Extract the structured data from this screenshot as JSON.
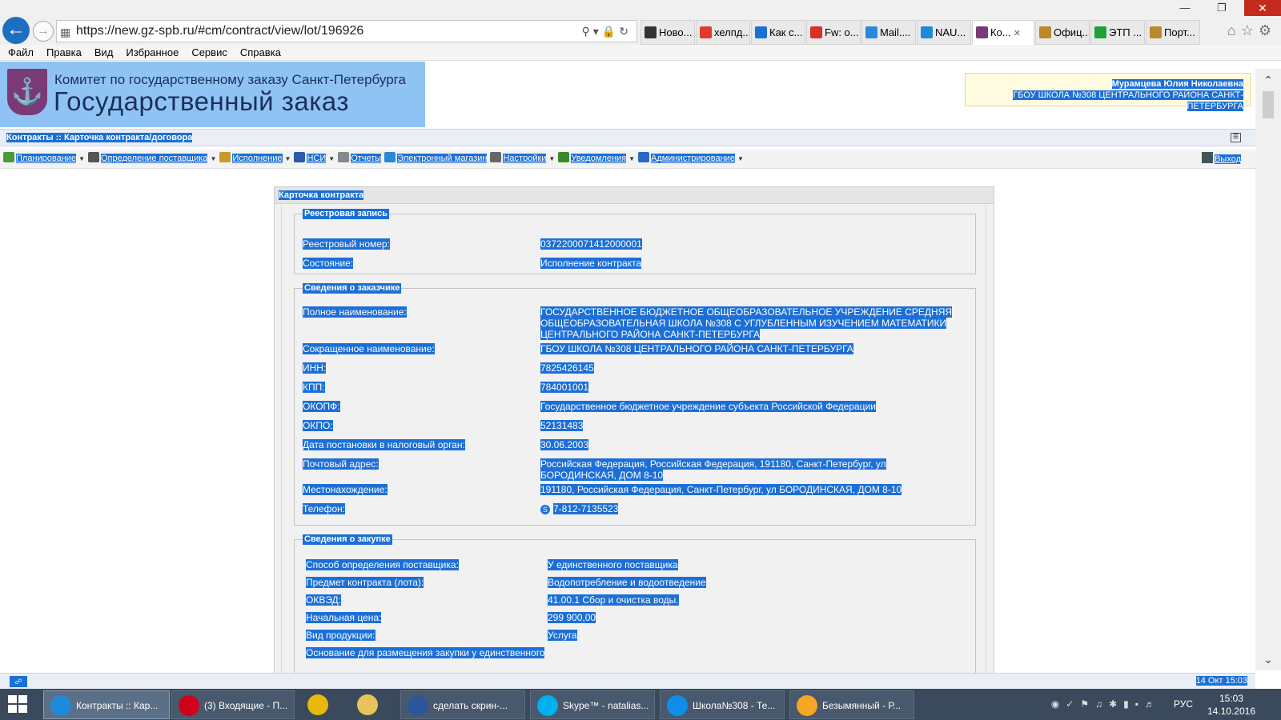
{
  "browser": {
    "url": "https://new.gz-spb.ru/#cm/contract/view/lot/196926",
    "tabs": [
      {
        "label": "Ново...",
        "icon": "document-icon",
        "color": "#333333"
      },
      {
        "label": "хелпд...",
        "icon": "yandex-icon",
        "color": "#e03a2f"
      },
      {
        "label": "Как с...",
        "icon": "help-icon",
        "color": "#1c6fd6"
      },
      {
        "label": "Fw: о...",
        "icon": "gmail-icon",
        "color": "#d93025"
      },
      {
        "label": "Mail....",
        "icon": "mail-icon",
        "color": "#2a88d8"
      },
      {
        "label": "NAU...",
        "icon": "ie-icon",
        "color": "#1e8ad8"
      },
      {
        "label": "Ко...",
        "icon": "gz-icon",
        "color": "#7a3a78",
        "active": true
      },
      {
        "label": "Офиц...",
        "icon": "emblem-icon",
        "color": "#b88a2c"
      },
      {
        "label": "ЭТП ...",
        "icon": "sberbank-icon",
        "color": "#21a038"
      },
      {
        "label": "Порт...",
        "icon": "emblem-icon",
        "color": "#b88a2c"
      }
    ],
    "menu": [
      "Файл",
      "Правка",
      "Вид",
      "Избранное",
      "Сервис",
      "Справка"
    ]
  },
  "header": {
    "subtitle": "Комитет по государственному заказу Санкт-Петербурга",
    "title": "Государственный заказ",
    "user_name": "Мурамцева Юлия Николаевна",
    "user_org": "ГБОУ ШКОЛА №308 ЦЕНТРАЛЬНОГО РАЙОНА САНКТ-ПЕТЕРБУРГА"
  },
  "breadcrumb": "Контракты :: Карточка контракта/договора",
  "toolbar": {
    "items": [
      {
        "label": "Планирование",
        "icon": "planning-icon",
        "color": "#4a9a3a",
        "caret": true
      },
      {
        "label": "Определение поставщика",
        "icon": "gear-icon",
        "color": "#555555",
        "caret": true
      },
      {
        "label": "Исполнение",
        "icon": "folders-icon",
        "color": "#c89a2a",
        "caret": true
      },
      {
        "label": "НСИ",
        "icon": "book-icon",
        "color": "#2a5aa8",
        "caret": true
      },
      {
        "label": "Отчеты",
        "icon": "report-icon",
        "color": "#888888",
        "caret": false
      },
      {
        "label": "Электронный магазин",
        "icon": "cart-icon",
        "color": "#2a88d8",
        "caret": false
      },
      {
        "label": "Настройки",
        "icon": "wrench-icon",
        "color": "#666666",
        "caret": true
      },
      {
        "label": "Уведомления",
        "icon": "notification-icon",
        "color": "#3a8a2a",
        "caret": true
      },
      {
        "label": "Администрирование",
        "icon": "user-icon",
        "color": "#2a68c8",
        "caret": true
      }
    ],
    "exit_label": "Выход"
  },
  "card": {
    "title": "Карточка контракта",
    "registry": {
      "legend": "Реестровая запись",
      "rows": [
        {
          "label": "Реестровый номер:",
          "value": "0372200071412000001"
        },
        {
          "label": "Состояние:",
          "value": "Исполнение контракта"
        }
      ]
    },
    "customer": {
      "legend": "Сведения о заказчике",
      "rows": [
        {
          "label": "Полное наименование:",
          "value": "ГОСУДАРСТВЕННОЕ БЮДЖЕТНОЕ ОБЩЕОБРАЗОВАТЕЛЬНОЕ УЧРЕЖДЕНИЕ СРЕДНЯЯ ОБЩЕОБРАЗОВАТЕЛЬНАЯ ШКОЛА №308 С УГЛУБЛЕННЫМ ИЗУЧЕНИЕМ МАТЕМАТИКИ ЦЕНТРАЛЬНОГО РАЙОНА САНКТ-ПЕТЕРБУРГА"
        },
        {
          "label": "Сокращенное наименование:",
          "value": "ГБОУ ШКОЛА №308 ЦЕНТРАЛЬНОГО РАЙОНА САНКТ-ПЕТЕРБУРГА"
        },
        {
          "label": "ИНН:",
          "value": "7825426145"
        },
        {
          "label": "КПП:",
          "value": "784001001"
        },
        {
          "label": "ОКОПФ:",
          "value": "Государственное бюджетное учреждение субъекта Российской Федерации"
        },
        {
          "label": "ОКПО:",
          "value": "52131483"
        },
        {
          "label": "Дата постановки в налоговый орган:",
          "value": "30.06.2003"
        },
        {
          "label": "Почтовый адрес:",
          "value": "Российская Федерация, Российская Федерация, 191180, Санкт-Петербург, ул БОРОДИНСКАЯ, ДОМ 8-10"
        },
        {
          "label": "Местонахождение:",
          "value": "191180, Российская Федерация, Санкт-Петербург, ул БОРОДИНСКАЯ, ДОМ 8-10"
        },
        {
          "label": "Телефон:",
          "value": "7-812-7135523"
        }
      ]
    },
    "purchase": {
      "legend": "Сведения о закупке",
      "rows": [
        {
          "label": "Способ определения поставщика:",
          "value": "У единственного поставщика"
        },
        {
          "label": "Предмет контракта (лота):",
          "value": "Водопотребление и водоотведение"
        },
        {
          "label": "ОКВЭД:",
          "value": "41.00.1 Сбор и очистка воды."
        },
        {
          "label": "Начальная цена:",
          "value": "299 900,00"
        },
        {
          "label": "Вид продукции:",
          "value": "Услуга"
        },
        {
          "label": "Основание для размещения закупки у единственного",
          "value": ""
        }
      ]
    }
  },
  "statusbar": {
    "datetime": "14 Окт 15:03"
  },
  "taskbar": {
    "items": [
      {
        "label": "Контракты :: Кар...",
        "icon": "ie-icon",
        "color": "#1e8ad8",
        "active": true
      },
      {
        "label": "(3) Входящие - П...",
        "icon": "opera-icon",
        "color": "#d0021b"
      },
      {
        "label": "",
        "icon": "chrome-icon",
        "color": "#e8b90b"
      },
      {
        "label": "",
        "icon": "explorer-icon",
        "color": "#e8c35a"
      },
      {
        "label": "сделать скрин-...",
        "icon": "word-icon",
        "color": "#2b579a"
      },
      {
        "label": "Skype™ - natalias...",
        "icon": "skype-icon",
        "color": "#00aff0"
      },
      {
        "label": "Школа№308 - Те...",
        "icon": "teamviewer-icon",
        "color": "#0e8ee9"
      },
      {
        "label": "Безымянный - Р...",
        "icon": "paint-icon",
        "color": "#f5a623"
      }
    ],
    "lang": "РУС",
    "time": "15:03",
    "date": "14.10.2016"
  }
}
